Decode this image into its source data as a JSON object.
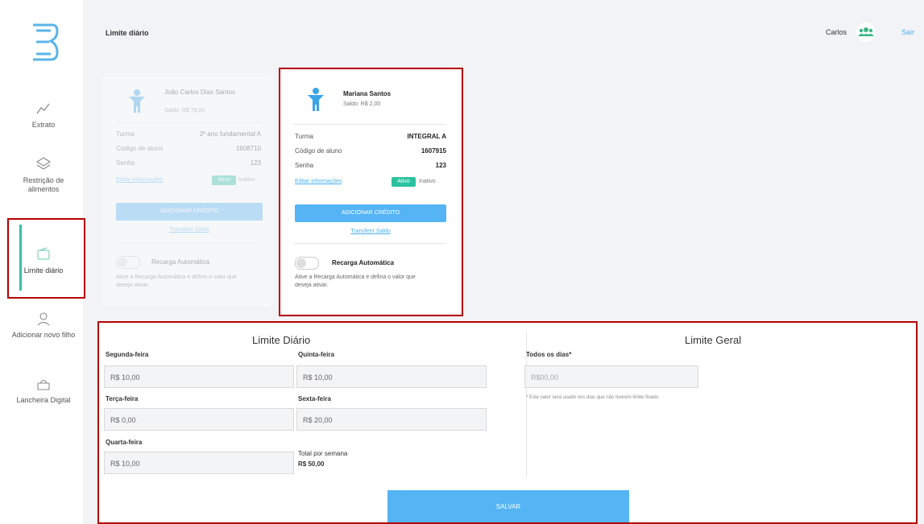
{
  "header": {
    "title": "Limite diário",
    "user_name": "Carlos",
    "user_icon": "users-icon",
    "exit_label": "Sair"
  },
  "sidebar": {
    "logo": "logo-3",
    "items": [
      {
        "label": "Extrato",
        "icon": "chart-line-icon"
      },
      {
        "label": "Restrição de alimentos",
        "icon": "layers-icon"
      },
      {
        "label": "Limite diário",
        "icon": "wallet-icon",
        "active": true
      },
      {
        "label": "Adicionar novo filho",
        "icon": "user-add-icon"
      },
      {
        "label": "Lancheira Digital",
        "icon": "basket-icon"
      }
    ]
  },
  "students": [
    {
      "name": "João Carlos Dias Santos",
      "balance": "Saldo: R$ 78,00",
      "turma_label": "Turma",
      "turma": "2º ano fundamental A",
      "code_label": "Código de aluno",
      "code": "1608710",
      "password_label": "Senha",
      "password": "123",
      "edit_label": "Editar informações",
      "toggle_label": "Ativo",
      "status_label": "Inativo",
      "credit_button": "ADICIONAR CRÉDITO",
      "transfer_label": "Transferir Saldo",
      "recharge_title": "Recarga Automática",
      "recharge_desc": "Ative a Recarga Automática e defina o valor que deseja ativar."
    },
    {
      "name": "Mariana Santos",
      "balance": "Saldo: R$ 2,00",
      "turma_label": "Turma",
      "turma": "INTEGRAL A",
      "code_label": "Código de aluno",
      "code": "1607915",
      "password_label": "Senha",
      "password": "123",
      "edit_label": "Editar informações",
      "toggle_label": "Ativo",
      "status_label": "Inativo",
      "credit_button": "ADICIONAR CRÉDITO",
      "transfer_label": "Transferir Saldo",
      "recharge_title": "Recarga Automática",
      "recharge_desc": "Ative a Recarga Automática e defina o valor que deseja ativar."
    }
  ],
  "limite_diario": {
    "title": "Limite Diário",
    "days": [
      {
        "label": "Segunda-feira",
        "value": "R$ 10,00"
      },
      {
        "label": "Terça-feira",
        "value": "R$ 0,00"
      },
      {
        "label": "Quarta-feira",
        "value": "R$ 10,00"
      },
      {
        "label": "Quinta-feira",
        "value": "R$ 10,00"
      },
      {
        "label": "Sexta-feira",
        "value": "R$ 20,00"
      }
    ],
    "total_label": "Total por semana",
    "total_value": "R$ 50,00"
  },
  "limite_geral": {
    "title": "Limite Geral",
    "label": "Todos os dias*",
    "placeholder": "R$00,00",
    "note": "* Este valor será usado nos dias que não tiverem limite fixado."
  },
  "save_label": "SALVAR",
  "colors": {
    "accent": "#55b4f4",
    "active": "#39c0a6",
    "highlight": "#b50000"
  }
}
